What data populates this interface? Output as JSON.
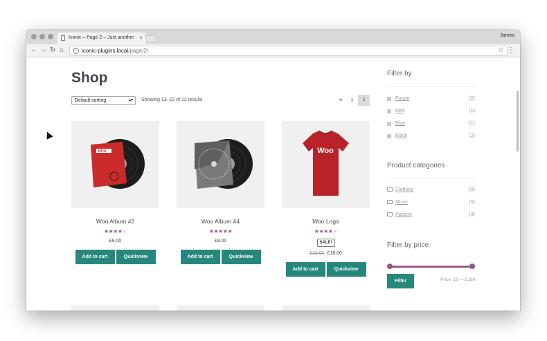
{
  "browser": {
    "tab_title": "Iconic – Page 2 – Just another",
    "tab_close": "×",
    "profile_name": "James",
    "url_host": "iconic-plugins.local",
    "url_path": "/page/2/",
    "nav": {
      "back": "←",
      "forward": "→",
      "reload": "↻",
      "home": "⌂",
      "star": "☆",
      "menu": "⋮",
      "info": "i"
    }
  },
  "shop": {
    "title": "Shop",
    "sorting": "Default sorting",
    "result_count": "Showing 13–22 of 22 results",
    "pagination": {
      "prev": "◂",
      "pages": [
        "1",
        "2"
      ],
      "current": "2"
    }
  },
  "products": [
    {
      "name": "Woo Album #2",
      "rating": 4,
      "rating_out_of": 5,
      "price": "£9.00",
      "sale": false,
      "add_to_cart": "Add to cart",
      "quickview": "Quickview"
    },
    {
      "name": "Woo Album #4",
      "rating": 5,
      "rating_out_of": 5,
      "price": "£9.00",
      "sale": false,
      "add_to_cart": "Add to cart",
      "quickview": "Quickview"
    },
    {
      "name": "Woo Logo",
      "rating": 4,
      "rating_out_of": 5,
      "sale": true,
      "sale_badge": "SALE!",
      "regular_price": "£20.00",
      "price": "£18.00",
      "add_to_cart": "Add to cart",
      "quickview": "Quickview"
    }
  ],
  "product_art": {
    "album2_label": "WOO",
    "shirt_text": "Woo"
  },
  "sidebar": {
    "filter_by": {
      "heading": "Filter by",
      "items": [
        {
          "label": "Purple",
          "count": "(2)"
        },
        {
          "label": "Red",
          "count": "(1)"
        },
        {
          "label": "Blue",
          "count": "(1)"
        },
        {
          "label": "Black",
          "count": "(2)"
        }
      ]
    },
    "categories": {
      "heading": "Product categories",
      "items": [
        {
          "label": "Clothing",
          "count": "(9)"
        },
        {
          "label": "Music",
          "count": "(5)"
        },
        {
          "label": "Posters",
          "count": "(3)"
        }
      ]
    },
    "price_filter": {
      "heading": "Filter by price",
      "button": "Filter",
      "range_text": "Price: £9 — £180",
      "min_value": 9,
      "max_value": 180
    }
  },
  "colors": {
    "accent_button": "#26887c",
    "accent_purple": "#96588a"
  }
}
